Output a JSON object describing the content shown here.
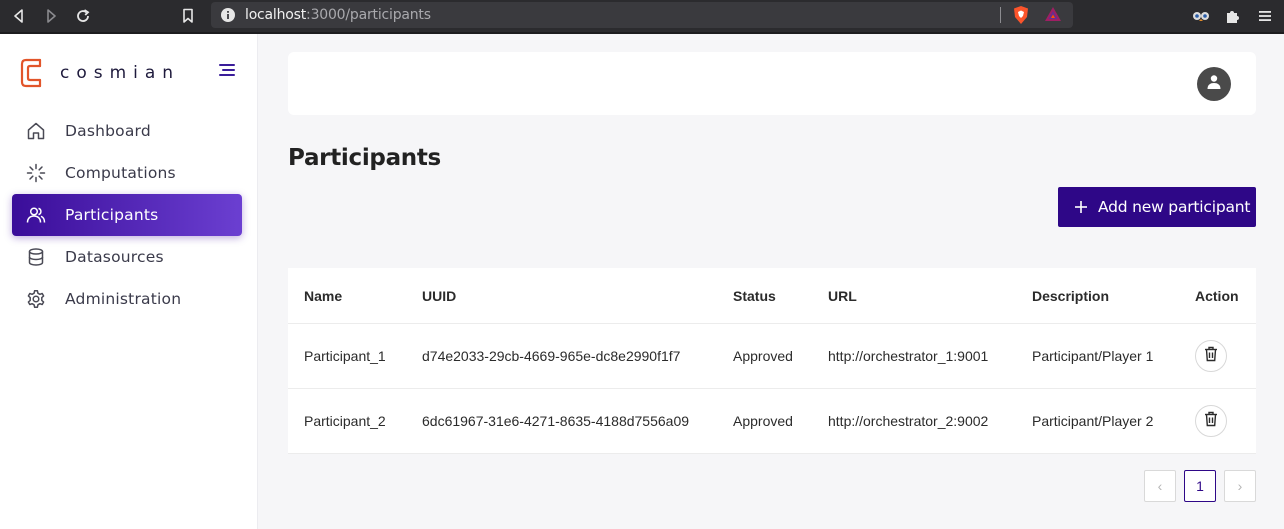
{
  "browser": {
    "url_host": "localhost",
    "url_rest": ":3000/participants"
  },
  "sidebar": {
    "logo_text": "cosmian",
    "items": [
      {
        "label": "Dashboard",
        "icon": "home-icon"
      },
      {
        "label": "Computations",
        "icon": "loader-icon"
      },
      {
        "label": "Participants",
        "icon": "users-icon",
        "active": true
      },
      {
        "label": "Datasources",
        "icon": "database-icon"
      },
      {
        "label": "Administration",
        "icon": "gear-icon"
      }
    ]
  },
  "main": {
    "title": "Participants",
    "add_button_label": "Add new participant",
    "table": {
      "headers": [
        "Name",
        "UUID",
        "Status",
        "URL",
        "Description",
        "Action"
      ],
      "rows": [
        {
          "name": "Participant_1",
          "uuid": "d74e2033-29cb-4669-965e-dc8e2990f1f7",
          "status": "Approved",
          "url": "http://orchestrator_1:9001",
          "description": "Participant/Player 1"
        },
        {
          "name": "Participant_2",
          "uuid": "6dc61967-31e6-4271-8635-4188d7556a09",
          "status": "Approved",
          "url": "http://orchestrator_2:9002",
          "description": "Participant/Player 2"
        }
      ]
    },
    "pagination": {
      "prev": "‹",
      "current_page": "1",
      "next": "›"
    }
  },
  "colors": {
    "accent": "#2e0787",
    "active_gradient_start": "#3a0d99",
    "active_gradient_end": "#6b3fd1",
    "logo_orange": "#e2552a"
  }
}
